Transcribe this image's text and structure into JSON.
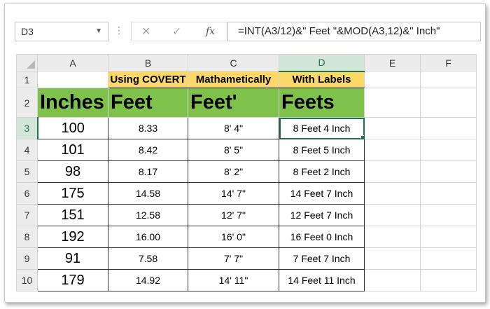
{
  "formula_bar": {
    "name_box": "D3",
    "formula": "=INT(A3/12)&\" Feet \"&MOD(A3,12)&\" Inch\""
  },
  "columns": [
    "A",
    "B",
    "C",
    "D",
    "E",
    "F"
  ],
  "rows": [
    "1",
    "2",
    "3",
    "4",
    "5",
    "6",
    "7",
    "8",
    "9",
    "10"
  ],
  "row1": {
    "a": "",
    "b": "Using COVERT",
    "c": "Mathametically",
    "d": "With Labels"
  },
  "row2": {
    "a": "Inches",
    "b": "Feet",
    "c": "Feet'",
    "d": "Feets"
  },
  "data": [
    {
      "a": "100",
      "b": "8.33",
      "c": "8' 4\"",
      "d": "8 Feet 4 Inch"
    },
    {
      "a": "101",
      "b": "8.42",
      "c": "8' 5\"",
      "d": "8 Feet 5 Inch"
    },
    {
      "a": "98",
      "b": "8.17",
      "c": "8' 2\"",
      "d": "8 Feet 2 Inch"
    },
    {
      "a": "175",
      "b": "14.58",
      "c": "14' 7\"",
      "d": "14 Feet 7 Inch"
    },
    {
      "a": "151",
      "b": "12.58",
      "c": "12' 7\"",
      "d": "12 Feet 7 Inch"
    },
    {
      "a": "192",
      "b": "16.00",
      "c": "16' 0\"",
      "d": "16 Feet 0 Inch"
    },
    {
      "a": "91",
      "b": "7.58",
      "c": "7' 7\"",
      "d": "7 Feet 7 Inch"
    },
    {
      "a": "179",
      "b": "14.92",
      "c": "14' 11\"",
      "d": "14 Feet 11 Inch"
    }
  ],
  "colors": {
    "header_yellow": "#ffd966",
    "header_green": "#7fc24b",
    "excel_green": "#217346"
  }
}
